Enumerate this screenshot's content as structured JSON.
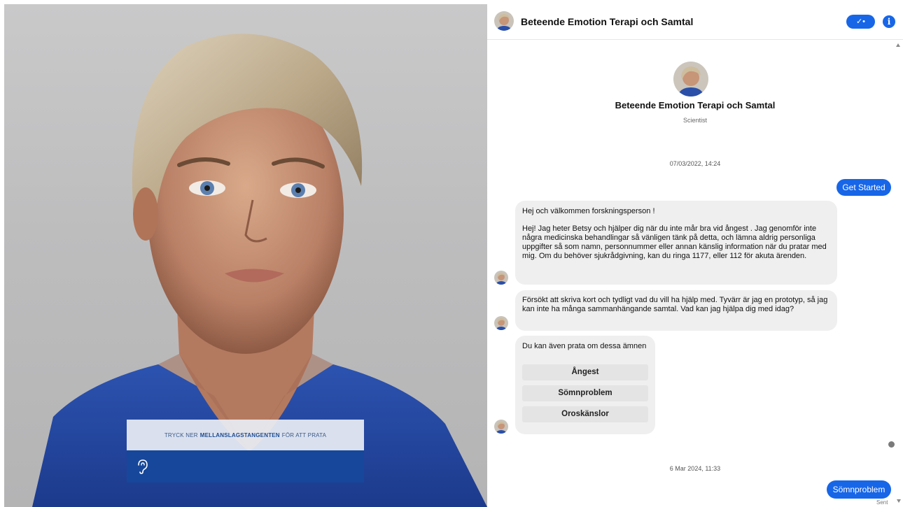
{
  "avatar_panel": {
    "speak_hint_prefix": "TRYCK NER",
    "speak_hint_key": "MELLANSLAGSTANGENTEN",
    "speak_hint_suffix": "FÖR ATT PRATA",
    "ear_icon": "ear-icon"
  },
  "chat": {
    "header_title": "Beteende Emotion Terapi och Samtal",
    "header_button_label": "✓•",
    "info_icon_label": "i",
    "profile_name": "Beteende Emotion Terapi och Samtal",
    "profile_role": "Scientist",
    "timestamp_1": "07/03/2022, 14:24",
    "get_started_label": "Get Started",
    "msg1_greeting": "Hej och välkommen forskningsperson !",
    "msg1_body": "Hej! Jag heter Betsy och hjälper dig när du inte mår bra vid ångest . Jag genomför inte några medicinska behandlingar så vänligen tänk på detta, och lämna aldrig personliga uppgifter så som namn, personnummer eller annan känslig information när du pratar med mig. Om du behöver sjukrådgivning, kan du ringa 1177, eller 112 för akuta ärenden.",
    "msg2_body": "Försökt att skriva kort och tydligt vad du vill ha hjälp med. Tyvärr är jag en prototyp, så jag kan inte ha många sammanhängande samtal. Vad kan jag hjälpa dig med idag?",
    "msg3_intro": "Du kan även prata om dessa ämnen",
    "quick_replies": [
      "Ångest",
      "Sömnproblem",
      "Oroskänslor"
    ],
    "timestamp_2": "6 Mar 2024, 11:33",
    "user_reply": "Sömnproblem",
    "sent_label": "Sent"
  },
  "colors": {
    "accent": "#1766e8",
    "speak_bar": "#16479a",
    "bubble": "#efefef"
  }
}
